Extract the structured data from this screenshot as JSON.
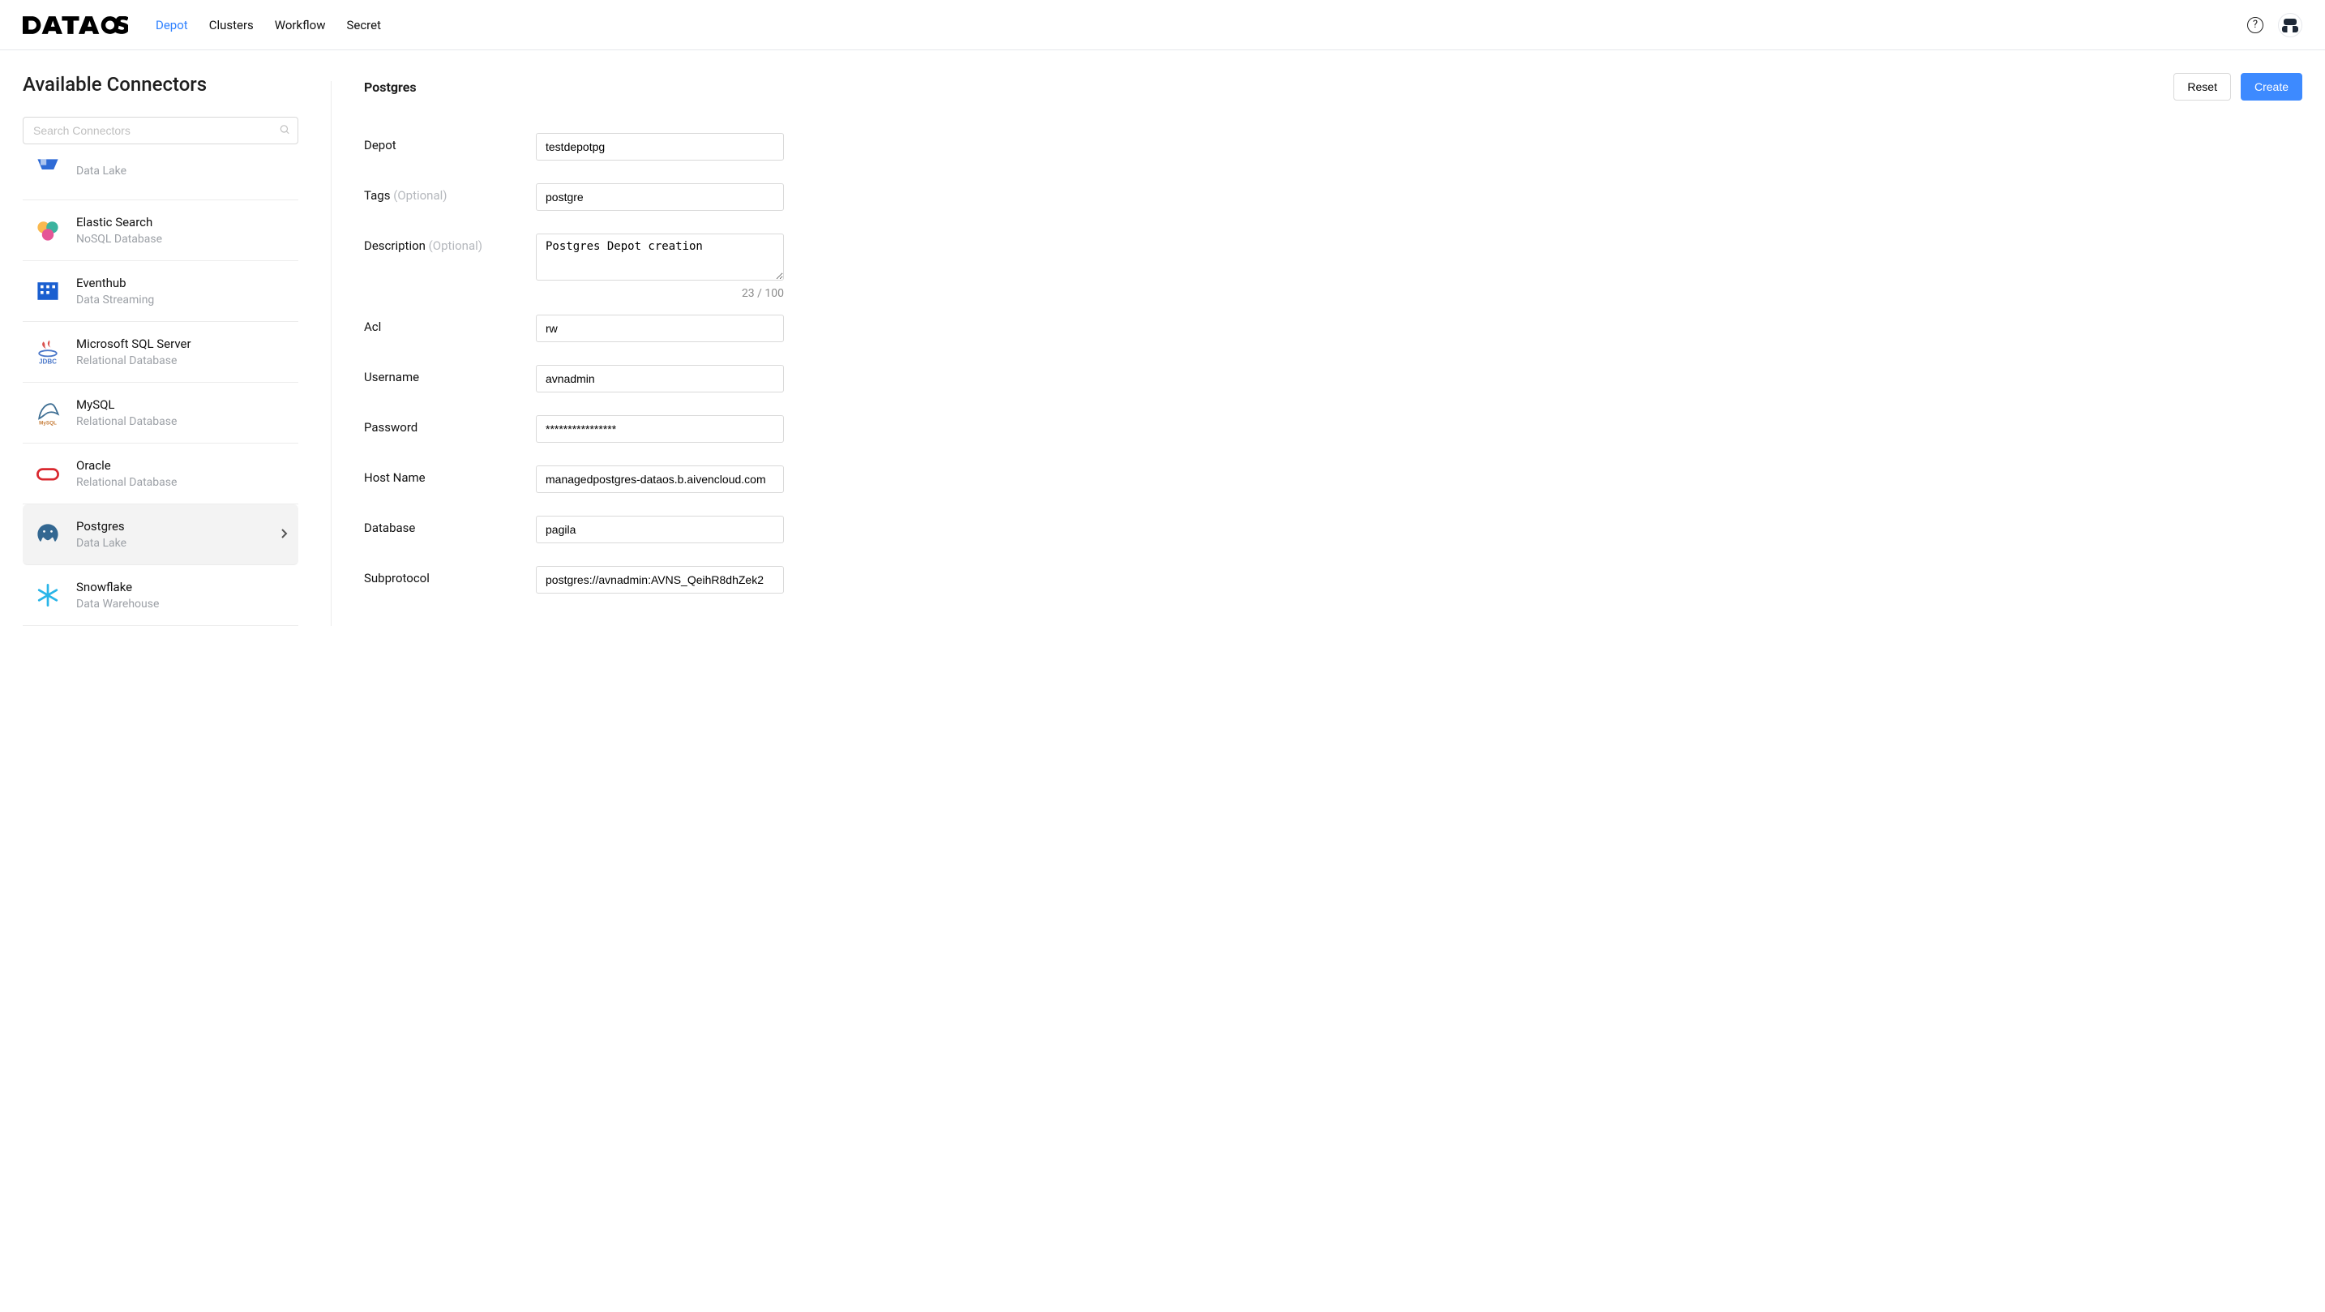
{
  "brand": "DataOS",
  "nav": [
    {
      "label": "Depot",
      "active": true
    },
    {
      "label": "Clusters"
    },
    {
      "label": "Workflow"
    },
    {
      "label": "Secret"
    }
  ],
  "sidebar": {
    "title": "Available Connectors",
    "searchPlaceholder": "Search Connectors",
    "items": [
      {
        "name": "",
        "sub": "Data Lake",
        "icon": "gcs"
      },
      {
        "name": "Elastic Search",
        "sub": "NoSQL Database",
        "icon": "elastic"
      },
      {
        "name": "Eventhub",
        "sub": "Data Streaming",
        "icon": "eventhub"
      },
      {
        "name": "Microsoft SQL Server",
        "sub": "Relational Database",
        "icon": "jdbc"
      },
      {
        "name": "MySQL",
        "sub": "Relational Database",
        "icon": "mysql"
      },
      {
        "name": "Oracle",
        "sub": "Relational Database",
        "icon": "oracle"
      },
      {
        "name": "Postgres",
        "sub": "Data Lake",
        "icon": "postgres",
        "selected": true
      },
      {
        "name": "Snowflake",
        "sub": "Data Warehouse",
        "icon": "snowflake"
      }
    ]
  },
  "form": {
    "title": "Postgres",
    "reset": "Reset",
    "create": "Create",
    "fields": {
      "depotLabel": "Depot",
      "depotValue": "testdepotpg",
      "tagsLabel": "Tags",
      "tagsOptional": "(Optional)",
      "tagsValue": "postgre",
      "descLabel": "Description",
      "descOptional": "(Optional)",
      "descValue": "Postgres Depot creation",
      "descCounter": "23 / 100",
      "aclLabel": "Acl",
      "aclValue": "rw",
      "usernameLabel": "Username",
      "usernameValue": "avnadmin",
      "passwordLabel": "Password",
      "passwordValue": "****************",
      "hostLabel": "Host Name",
      "hostValue": "managedpostgres-dataos.b.aivencloud.com",
      "databaseLabel": "Database",
      "databaseValue": "pagila",
      "subprotocolLabel": "Subprotocol",
      "subprotocolValue": "postgres://avnadmin:AVNS_QeihR8dhZek2"
    }
  }
}
